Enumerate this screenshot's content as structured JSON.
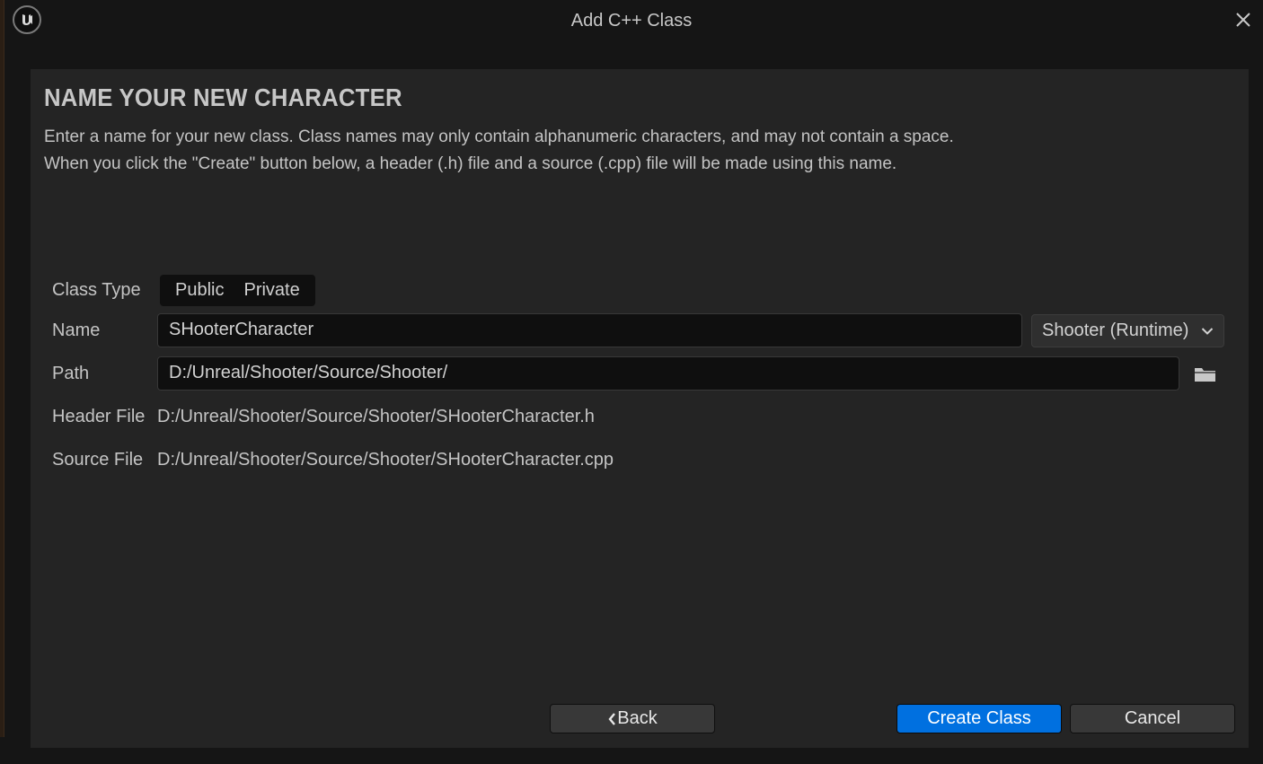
{
  "window": {
    "title": "Add C++ Class"
  },
  "icons": {
    "app_logo": "unreal-engine-logo",
    "close": "close-icon",
    "chevron": "chevron-down-icon",
    "folder": "folder-icon",
    "back_chevron": "chevron-left-icon"
  },
  "header": {
    "heading": "NAME YOUR NEW CHARACTER",
    "description_line1": "Enter a name for your new class. Class names may only contain alphanumeric characters, and may not contain a space.",
    "description_line2": "When you click the \"Create\" button below, a header (.h) file and a source (.cpp) file will be made using this name."
  },
  "form": {
    "class_type": {
      "label": "Class Type",
      "options": [
        "Public",
        "Private"
      ]
    },
    "name": {
      "label": "Name",
      "value": "SHooterCharacter",
      "module": "Shooter (Runtime)"
    },
    "path": {
      "label": "Path",
      "value": "D:/Unreal/Shooter/Source/Shooter/"
    },
    "header_file": {
      "label": "Header File",
      "value": "D:/Unreal/Shooter/Source/Shooter/SHooterCharacter.h"
    },
    "source_file": {
      "label": "Source File",
      "value": "D:/Unreal/Shooter/Source/Shooter/SHooterCharacter.cpp"
    }
  },
  "buttons": {
    "back": "Back",
    "create": "Create Class",
    "cancel": "Cancel"
  },
  "colors": {
    "accent": "#0070e0",
    "panel_bg": "#242424",
    "window_bg": "#151515",
    "field_bg": "#0f0f0f"
  }
}
